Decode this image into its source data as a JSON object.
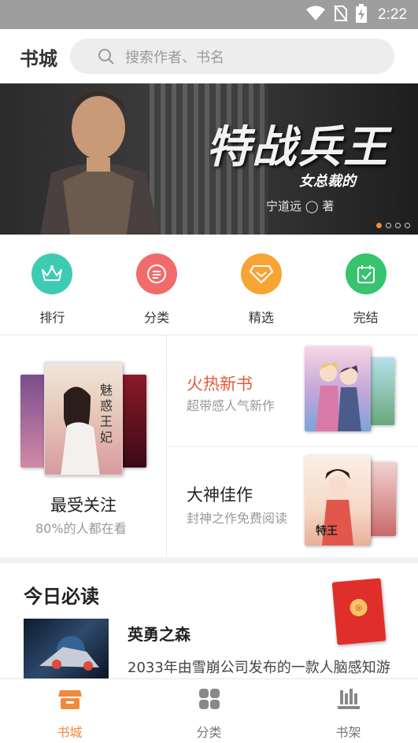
{
  "status_bar": {
    "time": "2:22",
    "icons": [
      "wifi-icon",
      "no-sim-icon",
      "battery-charging-icon"
    ]
  },
  "header": {
    "title": "书城",
    "search_placeholder": "搜索作者、书名"
  },
  "banner": {
    "title": "特战兵王",
    "subtitle": "女总裁的",
    "author": "宁道远 ◯ 著",
    "page_count": 4,
    "active_page": 1
  },
  "categories": [
    {
      "label": "排行",
      "icon": "crown-icon",
      "color": "#3ecbb4"
    },
    {
      "label": "分类",
      "icon": "list-icon",
      "color": "#f26b6b"
    },
    {
      "label": "精选",
      "icon": "diamond-icon",
      "color": "#f7a434"
    },
    {
      "label": "完结",
      "icon": "calendar-check-icon",
      "color": "#36c46f"
    }
  ],
  "features": {
    "most_followed": {
      "title": "最受关注",
      "subtitle": "80%的人都在看"
    },
    "hot_new": {
      "title": "火热新书",
      "subtitle": "超带感人气新作"
    },
    "great_works": {
      "title": "大神佳作",
      "subtitle": "封神之作免费阅读"
    }
  },
  "today": {
    "section_title": "今日必读",
    "book_title": "英勇之森",
    "book_desc": "2033年由雪崩公司发布的一款人脑感知游"
  },
  "bottom_nav": [
    {
      "label": "书城",
      "icon": "store-icon",
      "active": true
    },
    {
      "label": "分类",
      "icon": "grid-icon",
      "active": false
    },
    {
      "label": "书架",
      "icon": "bookshelf-icon",
      "active": false
    }
  ],
  "colors": {
    "accent": "#f08a3c",
    "status_bar": "#9e9e9e",
    "hot_new_title": "#e05a3a"
  }
}
